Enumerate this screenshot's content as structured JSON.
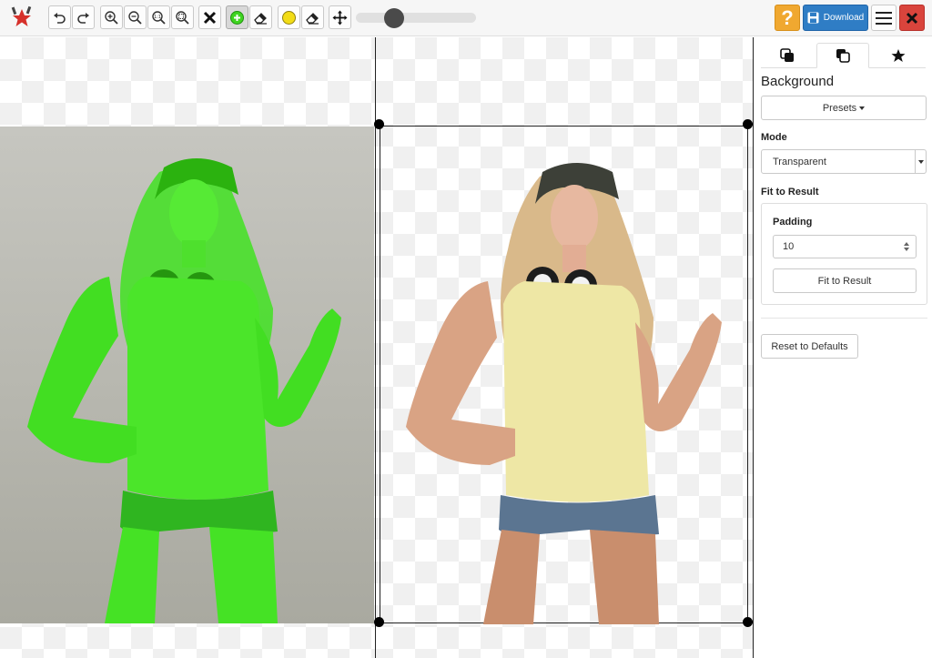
{
  "colors": {
    "mask_green": "#3fe71c",
    "download_blue": "#2f7dc5",
    "help_orange": "#f0a830",
    "close_red": "#d9443c",
    "marker_yellow": "#f2dc16"
  },
  "toolbar": {
    "logo_icon": "star-logo-icon",
    "tools": [
      {
        "name": "undo-icon"
      },
      {
        "name": "redo-icon"
      },
      {
        "name": "zoom-in-icon"
      },
      {
        "name": "zoom-out-icon"
      },
      {
        "name": "zoom-actual-size-icon"
      },
      {
        "name": "zoom-fit-icon"
      },
      {
        "name": "clear-icon"
      },
      {
        "name": "foreground-marker-icon",
        "active": true
      },
      {
        "name": "foreground-eraser-icon"
      },
      {
        "name": "hair-marker-icon"
      },
      {
        "name": "hair-eraser-icon"
      },
      {
        "name": "pan-icon"
      }
    ],
    "brush_size_fraction": 0.32,
    "help_label": "?",
    "download_label": "Download"
  },
  "sidebar": {
    "tabs": [
      {
        "icon": "background-tab-icon"
      },
      {
        "icon": "result-tab-icon",
        "active": true
      },
      {
        "icon": "favorites-star-icon"
      }
    ],
    "title": "Background",
    "presets_label": "Presets",
    "mode_label": "Mode",
    "mode_value": "Transparent",
    "fit_label": "Fit to Result",
    "padding_label": "Padding",
    "padding_value": "10",
    "fit_button_label": "Fit to Result",
    "reset_label": "Reset to Defaults"
  }
}
